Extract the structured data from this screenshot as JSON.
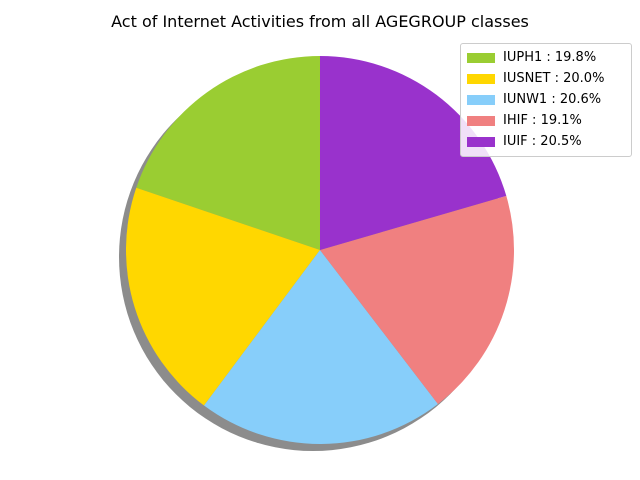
{
  "chart_data": {
    "type": "pie",
    "title": "Act of Internet Activities from all AGEGROUP classes",
    "slices": [
      {
        "label": "IUPH1",
        "value": 19.8,
        "display": "IUPH1 : 19.8%",
        "color": "#9acd32"
      },
      {
        "label": "IUSNET",
        "value": 20.0,
        "display": "IUSNET : 20.0%",
        "color": "#ffd700"
      },
      {
        "label": "IUNW1",
        "value": 20.6,
        "display": "IUNW1 : 20.6%",
        "color": "#87cefa"
      },
      {
        "label": "IHIF",
        "value": 19.1,
        "display": "IHIF : 19.1%",
        "color": "#f08080"
      },
      {
        "label": "IUIF",
        "value": 20.5,
        "display": "IUIF : 20.5%",
        "color": "#9932cc"
      }
    ],
    "start_angle_deg": 90,
    "direction": "counterclockwise",
    "shadow": true,
    "legend_position": "top-right"
  }
}
